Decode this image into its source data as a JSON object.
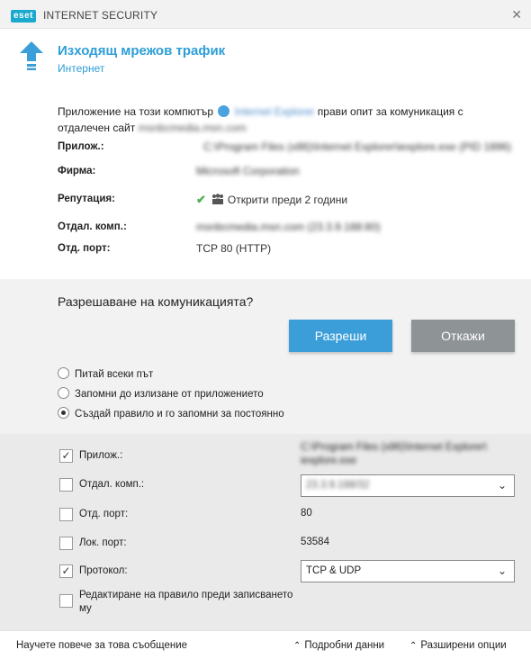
{
  "titlebar": {
    "logo": "eset",
    "product": "INTERNET SECURITY",
    "close": "✕"
  },
  "header": {
    "title": "Изходящ мрежов трафик",
    "subtitle": "Интернет",
    "icon": "arrow-up-icon"
  },
  "description": {
    "part1": "Приложение на този компютър",
    "app": "Internet Explorer",
    "part2": "прави опит за комуникация с",
    "part3": "отдалечен сайт",
    "site": "msnbcmedia.msn.com"
  },
  "details": [
    {
      "label": "Прилож.:",
      "value": "C:\\Program Files (x86)\\Internet Explorer\\iexplore.exe (PID 1896)",
      "blurred": true
    },
    {
      "label": "Фирма:",
      "value": "Microsoft Corporation",
      "blurred": true,
      "link": true
    },
    {
      "label": "Репутация:",
      "value": "Открити преди 2 години",
      "blurred": false
    },
    {
      "label": "Отдал. комп.:",
      "value": "msnbcmedia.msn.com (23.3.9.188:80)",
      "blurred": true
    },
    {
      "label": "Отд. порт:",
      "value": "TCP 80 (HTTP)",
      "blurred": false
    }
  ],
  "question": "Разрешаване на комуникацията?",
  "buttons": {
    "allow": "Разреши",
    "deny": "Откажи"
  },
  "radios": [
    {
      "label": "Питай всеки път",
      "selected": false
    },
    {
      "label": "Запомни до излизане от приложението",
      "selected": false
    },
    {
      "label": "Създай правило и го запомни за постоянно",
      "selected": true
    }
  ],
  "options": {
    "app": {
      "label": "Прилож.:",
      "checked": true,
      "value_line1": "C:\\Program Files (x86)\\Internet Explorer\\",
      "value_line2": "iexplore.exe"
    },
    "remote": {
      "label": "Отдал. комп.:",
      "checked": false,
      "value": "23.3.9.188/32"
    },
    "remote_port": {
      "label": "Отд. порт:",
      "checked": false,
      "value": "80"
    },
    "local_port": {
      "label": "Лок. порт:",
      "checked": false,
      "value": "53584"
    },
    "protocol": {
      "label": "Протокол:",
      "checked": true,
      "value": "TCP & UDP"
    },
    "edit": {
      "label_line1": "Редактиране на правило преди записването",
      "label_line2": "му",
      "checked": false
    }
  },
  "footer": {
    "learn_more": "Научете повече за това съобщение",
    "details": "Подробни данни",
    "advanced": "Разширени опции"
  }
}
